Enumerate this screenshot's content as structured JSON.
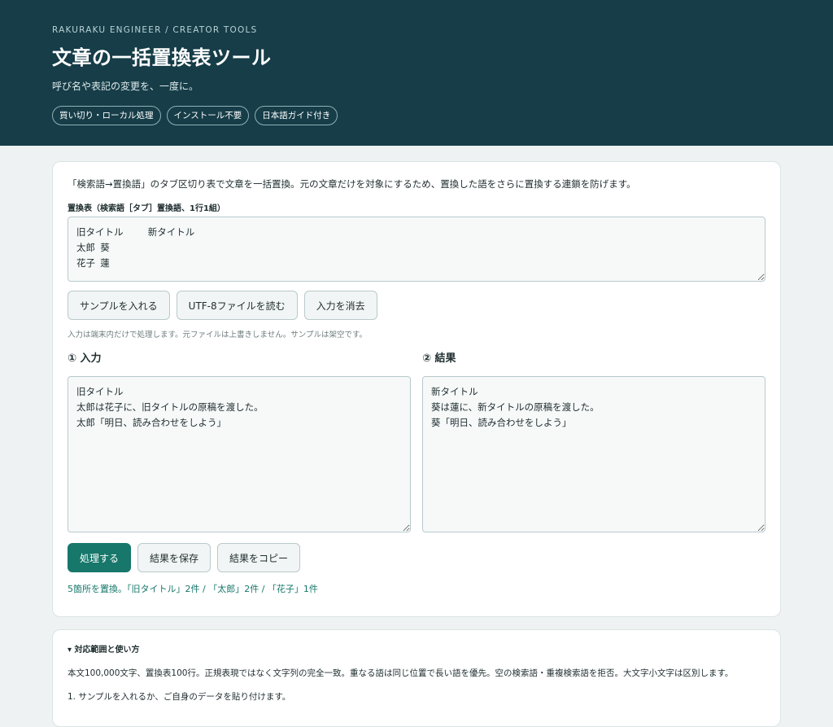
{
  "header": {
    "eyebrow": "RAKURAKU ENGINEER / CREATOR TOOLS",
    "title": "文章の一括置換表ツール",
    "subtitle": "呼び名や表記の変更を、一度に。",
    "chips": [
      "買い切り・ローカル処理",
      "インストール不要",
      "日本語ガイド付き"
    ]
  },
  "main": {
    "lead": "「検索語→置換語」のタブ区切り表で文章を一括置換。元の文章だけを対象にするため、置換した語をさらに置換する連鎖を防げます。",
    "table_label": "置換表（検索語［タブ］置換語、1行1組）",
    "table_value": "旧タイトル\t新タイトル\n太郎\t葵\n花子\t蓮",
    "buttons": {
      "sample": "サンプルを入れる",
      "read_file": "UTF-8ファイルを読む",
      "clear": "入力を消去"
    },
    "note": "入力は端末内だけで処理します。元ファイルは上書きしません。サンプルは架空です。",
    "input_heading": "① 入力",
    "input_value": "旧タイトル\n太郎は花子に、旧タイトルの原稿を渡した。\n太郎「明日、読み合わせをしよう」",
    "result_heading": "② 結果",
    "result_value": "新タイトル\n葵は蓮に、新タイトルの原稿を渡した。\n葵「明日、読み合わせをしよう」",
    "actions": {
      "process": "処理する",
      "save": "結果を保存",
      "copy": "結果をコピー"
    },
    "status": "5箇所を置換。「旧タイトル」2件 / 「太郎」2件 / 「花子」1件"
  },
  "help": {
    "summary": "▾ 対応範囲と使い方",
    "text": "本文100,000文字、置換表100行。正規表現ではなく文字列の完全一致。重なる語は同じ位置で長い語を優先。空の検索語・重複検索語を拒否。大文字小文字は区別します。",
    "step1": "1. サンプルを入れるか、ご自身のデータを貼り付けます。"
  },
  "colors": {
    "header_bg": "#163d48",
    "page_bg": "#eef2f2",
    "accent": "#16776a"
  }
}
